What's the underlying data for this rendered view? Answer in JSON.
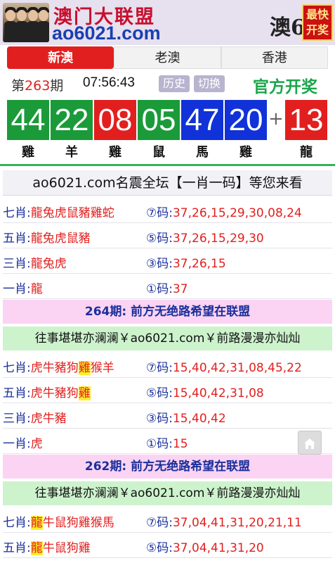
{
  "header": {
    "site_name": "澳门大联盟",
    "site_domain": "ao6021.com",
    "brand_mark": "澳6",
    "fast_badge_line1": "最快",
    "fast_badge_line2": "开奖"
  },
  "tabs": [
    {
      "label": "新澳",
      "active": true
    },
    {
      "label": "老澳",
      "active": false
    },
    {
      "label": "香港",
      "active": false
    }
  ],
  "draw": {
    "period_prefix": "第",
    "period_number": "263",
    "period_suffix": "期",
    "time": "07:56:43",
    "history_label": "历史",
    "switch_label": "切换",
    "official_label": "官方开奖",
    "balls": [
      {
        "number": "44",
        "color": "green",
        "zodiac": "雞"
      },
      {
        "number": "22",
        "color": "green",
        "zodiac": "羊"
      },
      {
        "number": "08",
        "color": "red",
        "zodiac": "雞"
      },
      {
        "number": "05",
        "color": "green",
        "zodiac": "鼠"
      },
      {
        "number": "47",
        "color": "blue",
        "zodiac": "馬"
      },
      {
        "number": "20",
        "color": "blue",
        "zodiac": "雞"
      }
    ],
    "plus": "+",
    "special": {
      "number": "13",
      "color": "red",
      "zodiac": "龍"
    }
  },
  "forum": {
    "title": "ao6021.com名震全坛【一肖一码】等您来看",
    "sections": [
      {
        "rows": [
          {
            "label": "七肖:",
            "zodiacs": "龍兔虎鼠豬雞蛇",
            "code_label": "⑦码:",
            "codes": "37,26,15,29,30,08,24"
          },
          {
            "label": "五肖:",
            "zodiacs": "龍兔虎鼠豬",
            "code_label": "⑤码:",
            "codes": "37,26,15,29,30"
          },
          {
            "label": "三肖:",
            "zodiacs": "龍兔虎",
            "code_label": "③码:",
            "codes": "37,26,15"
          },
          {
            "label": "一肖:",
            "zodiacs": "龍",
            "code_label": "①码:",
            "codes": "37"
          }
        ]
      },
      {
        "heading": "264期: 前方无绝路希望在联盟",
        "slogan": "往事堪堪亦澜澜￥ao6021.com￥前路漫漫亦灿灿",
        "rows": [
          {
            "label": "七肖:",
            "zodiacs_pre": "虎牛豬狗",
            "zodiacs_hl": "雞",
            "zodiacs_post": "猴羊",
            "code_label": "⑦码:",
            "codes": "15,40,42,31,08,45,22"
          },
          {
            "label": "五肖:",
            "zodiacs_pre": "虎牛豬狗",
            "zodiacs_hl": "雞",
            "zodiacs_post": "",
            "code_label": "⑤码:",
            "codes": "15,40,42,31,08"
          },
          {
            "label": "三肖:",
            "zodiacs_pre": "虎牛豬",
            "zodiacs_hl": "",
            "zodiacs_post": "",
            "code_label": "③码:",
            "codes": "15,40,42"
          },
          {
            "label": "一肖:",
            "zodiacs_pre": "虎",
            "zodiacs_hl": "",
            "zodiacs_post": "",
            "code_label": "①码:",
            "codes": "15"
          }
        ]
      },
      {
        "heading": "262期: 前方无绝路希望在联盟",
        "slogan": "往事堪堪亦澜澜￥ao6021.com￥前路漫漫亦灿灿",
        "rows": [
          {
            "label": "七肖:",
            "zodiacs_pre": "",
            "zodiacs_hl": "龍",
            "zodiacs_post": "牛鼠狗雞猴馬",
            "code_label": "⑦码:",
            "codes": "37,04,41,31,20,21,11"
          },
          {
            "label": "五肖:",
            "zodiacs_pre": "",
            "zodiacs_hl": "龍",
            "zodiacs_post": "牛鼠狗雞",
            "code_label": "⑤码:",
            "codes": "37,04,41,31,20"
          }
        ]
      }
    ]
  },
  "colors": {
    "accent_red": "#e21f1f",
    "ball_green": "#1b9a3a",
    "ball_blue": "#1032d8",
    "official_green": "#1aa64a",
    "band_pink": "#fbd4f4",
    "band_green": "#cdf3cd",
    "highlight_yellow": "#ffef2c"
  },
  "icons": {
    "back_to_top": "home-icon"
  }
}
